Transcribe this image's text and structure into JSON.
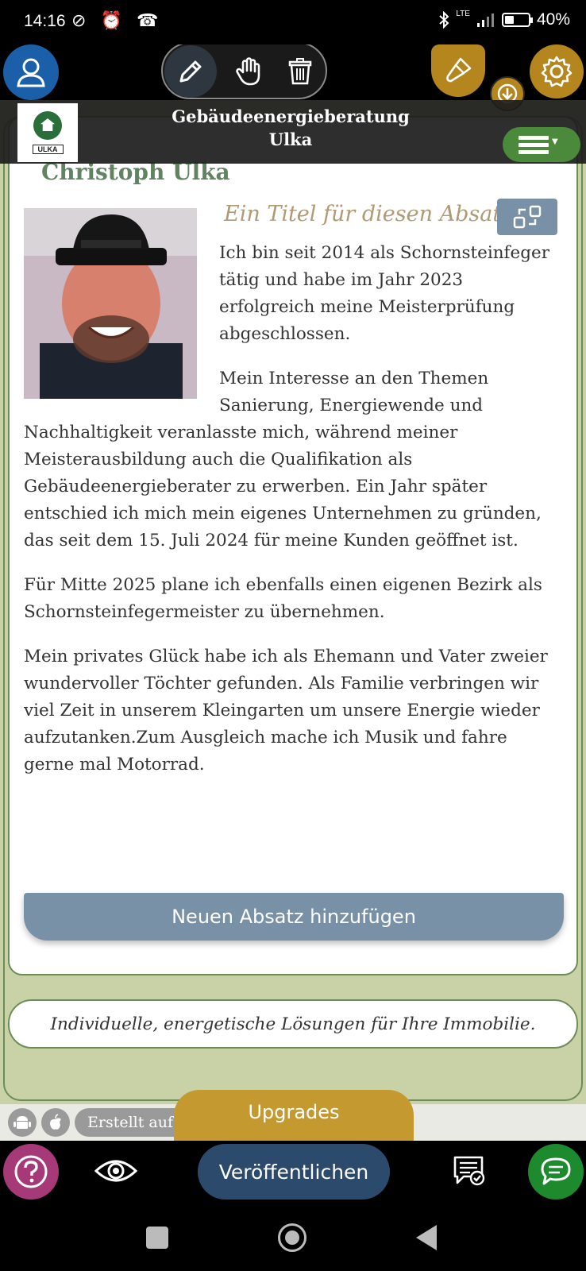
{
  "status_bar": {
    "time": "14:16",
    "left_icons": "⊘ ⏰ ☎",
    "battery": "40%",
    "battery_level": 0.4,
    "network": "LTE"
  },
  "toolbar": {
    "user_icon": "user-icon",
    "edit_icon": "pencil-icon",
    "move_icon": "hand-icon",
    "delete_icon": "trash-icon",
    "design_icon": "brush-icon",
    "download_icon": "download-arrow-icon",
    "settings_icon": "gear-icon"
  },
  "site_header": {
    "title_line1": "Gebäudeenergieberatung",
    "title_line2": "Ulka",
    "logo_text": "ULKA"
  },
  "content": {
    "page_name": "Christoph Ulka",
    "paragraph_title": "Ein Titel für diesen Absatz",
    "p1_lines": [
      "Ich bin seit 2014 als Schornsteinfeger",
      "tätig und habe im Jahr 2023",
      "erfolgreich meine Meisterprüfung",
      "abgeschlossen."
    ],
    "p2_lines_short": [
      "Mein Interesse an den Themen",
      "Sanierung, Energiewende und"
    ],
    "p2_lines_full": [
      "Nachhaltigkeit veranlasste mich, während meiner",
      "Meisterausbildung auch die Qualifikation als",
      "Gebäudeenergieberater zu erwerben. Ein Jahr später",
      "entschied ich mich mein eigenes Unternehmen zu gründen,",
      "das seit dem 15. Juli 2024 für meine Kunden geöffnet ist."
    ],
    "p3_lines": [
      "Für Mitte 2025 plane ich ebenfalls einen eigenen Bezirk als",
      "Schornsteinfegermeister zu übernehmen."
    ],
    "p4_lines": [
      "Mein privates Glück habe ich als Ehemann und Vater zweier",
      "wundervoller Töchter gefunden. Als Familie verbringen wir",
      "viel Zeit in unserem Kleingarten um unsere Energie wieder",
      "aufzutanken.Zum Ausgleich mache ich Musik und fahre",
      "gerne mal Motorrad."
    ],
    "add_paragraph_button": "Neuen Absatz hinzufügen"
  },
  "slogan": "Individuelle, energetische Lösungen für Ihre Immobilie.",
  "footer": {
    "created_text": "Erstellt auf r",
    "upgrades_button": "Upgrades"
  },
  "bottom_bar": {
    "publish_button": "Veröffentlichen"
  },
  "colors": {
    "brand_green": "#4a8a3a",
    "gold": "#b5861d",
    "publish_blue": "#2c4a6c",
    "slate": "#7991a6",
    "help_purple": "#a63a78",
    "chat_green": "#1e8a2e"
  }
}
